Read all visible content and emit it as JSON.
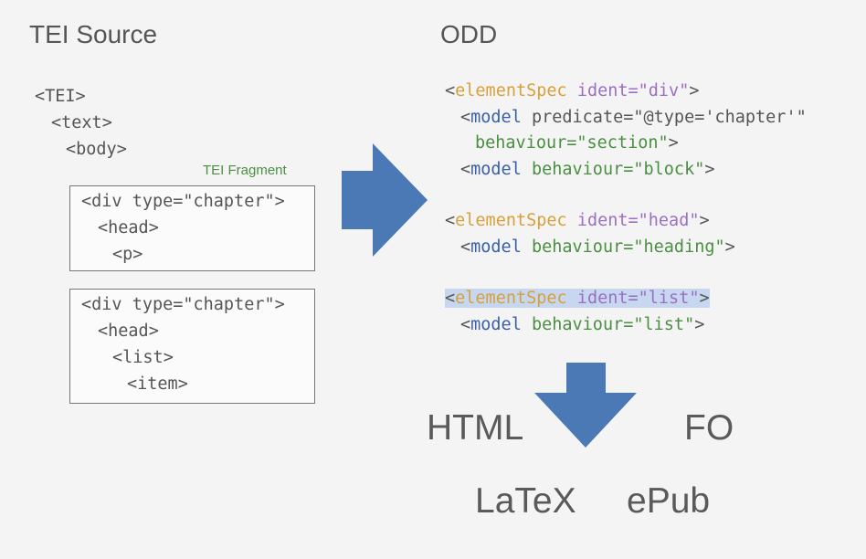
{
  "headings": {
    "left": "TEI Source",
    "right": "ODD"
  },
  "tei_source": {
    "lines": [
      "<TEI>",
      "<text>",
      "<body>"
    ],
    "fragment_label": "TEI Fragment",
    "box1": [
      "<div type=\"chapter\">",
      "<head>",
      "<p>"
    ],
    "box2": [
      "<div type=\"chapter\">",
      "<head>",
      "<list>",
      "<item>"
    ]
  },
  "odd": {
    "spec1": {
      "open": "<",
      "name": "elementSpec",
      "attr": "ident=",
      "value": "\"div\"",
      "close": ">",
      "model1_open": "<",
      "model1_name": "model",
      "model1_attr": "predicate=",
      "model1_value": "\"@type='chapter'\"",
      "model1_attr2": "behaviour=",
      "model1_value2": "\"section\"",
      "model1_close": ">",
      "model2_open": "<",
      "model2_name": "model",
      "model2_attr": "behaviour=",
      "model2_value": "\"block\"",
      "model2_close": ">"
    },
    "spec2": {
      "open": "<",
      "name": "elementSpec",
      "attr": "ident=",
      "value": "\"head\"",
      "close": ">",
      "model_open": "<",
      "model_name": "model",
      "model_attr": "behaviour=",
      "model_value": "\"heading\"",
      "model_close": ">"
    },
    "spec3": {
      "open": "<",
      "name": "elementSpec",
      "attr": "ident=",
      "value": "\"list\"",
      "close": ">",
      "model_open": "<",
      "model_name": "model",
      "model_attr": "behaviour=",
      "model_value": "\"list\"",
      "model_close": ">"
    }
  },
  "outputs": [
    "HTML",
    "FO",
    "LaTeX",
    "ePub"
  ],
  "colors": {
    "arrow": "#4a79b5",
    "element_name": "#d9a03a",
    "model_name": "#3a5fa8",
    "ident_attr": "#9b6fc2",
    "model_attr": "#4b8f42",
    "highlight": "#c6d7ef"
  }
}
